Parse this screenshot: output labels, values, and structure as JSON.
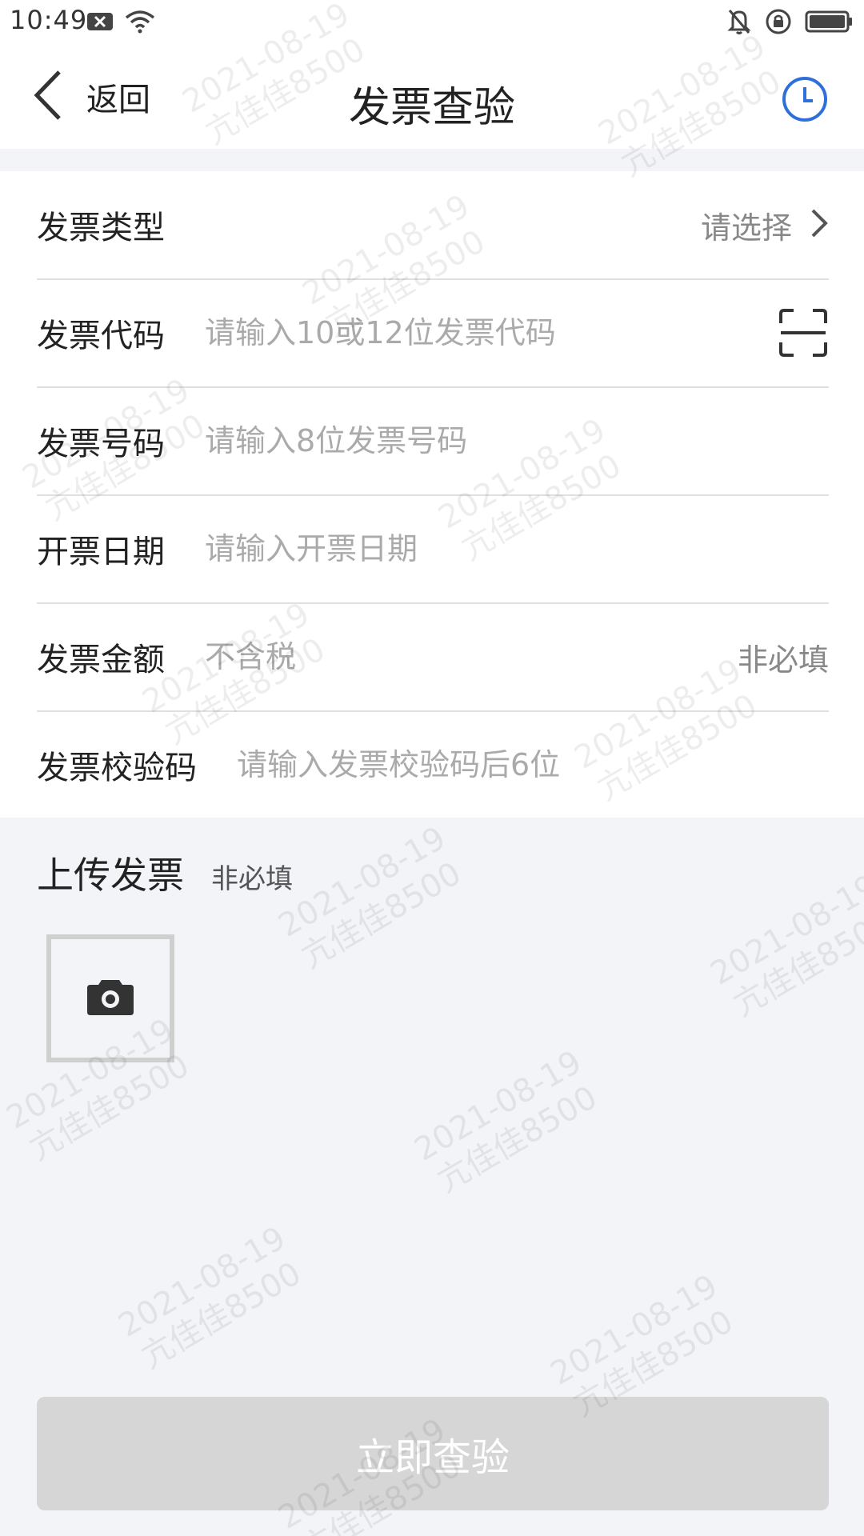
{
  "status_bar": {
    "time": "10:49",
    "icons": [
      "notification-x-icon",
      "wifi-icon",
      "bell-off-icon",
      "rotation-lock-icon",
      "battery-icon"
    ]
  },
  "nav": {
    "back_label": "返回",
    "title": "发票查验",
    "history_icon": "clock-icon",
    "accent_color": "#2f6fdc"
  },
  "form": {
    "invoice_type": {
      "label": "发票类型",
      "value": "请选择"
    },
    "invoice_code": {
      "label": "发票代码",
      "placeholder": "请输入10或12位发票代码",
      "scan_icon": "scan-icon"
    },
    "invoice_number": {
      "label": "发票号码",
      "placeholder": "请输入8位发票号码"
    },
    "issue_date": {
      "label": "开票日期",
      "placeholder": "请输入开票日期"
    },
    "invoice_amount": {
      "label": "发票金额",
      "placeholder": "不含税",
      "suffix": "非必填"
    },
    "check_code": {
      "label": "发票校验码",
      "placeholder": "请输入发票校验码后6位"
    }
  },
  "upload": {
    "title": "上传发票",
    "optional": "非必填",
    "icon": "camera-icon"
  },
  "submit": {
    "label": "立即查验"
  },
  "watermark": {
    "line1": "2021-08-19",
    "line2": "亢佳佳8500"
  }
}
